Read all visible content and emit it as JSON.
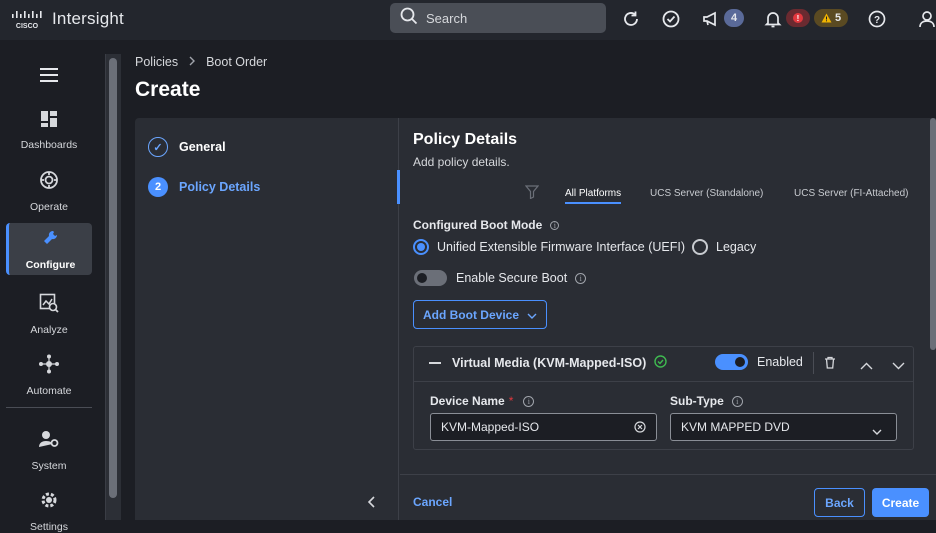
{
  "app": {
    "brand": "Intersight"
  },
  "topbar": {
    "search_label": "Search",
    "announcements_count": "4",
    "alarms_critical_icon": "!",
    "alarms_warning_count": "5",
    "help_icon": "?"
  },
  "sidebar": {
    "items": [
      {
        "label": "Dashboards",
        "icon": "dashboards-icon"
      },
      {
        "label": "Operate",
        "icon": "operate-icon"
      },
      {
        "label": "Configure",
        "icon": "configure-icon"
      },
      {
        "label": "Analyze",
        "icon": "analyze-icon"
      },
      {
        "label": "Automate",
        "icon": "automate-icon"
      },
      {
        "label": "System",
        "icon": "system-icon"
      },
      {
        "label": "Settings",
        "icon": "settings-icon"
      }
    ]
  },
  "breadcrumb": {
    "items": [
      "Policies",
      "Boot Order"
    ]
  },
  "page": {
    "title": "Create"
  },
  "steps": [
    {
      "label": "General",
      "marker": "✓"
    },
    {
      "label": "Policy Details",
      "marker": "2"
    }
  ],
  "policy": {
    "title": "Policy Details",
    "subtitle": "Add policy details.",
    "tabs": [
      "All Platforms",
      "UCS Server (Standalone)",
      "UCS Server (FI-Attached)"
    ],
    "boot_mode_label": "Configured Boot Mode",
    "boot_mode_options": [
      "Unified Extensible Firmware Interface (UEFI)",
      "Legacy"
    ],
    "secure_boot_label": "Enable Secure Boot",
    "add_device_label": "Add Boot Device"
  },
  "device": {
    "title": "Virtual Media (KVM-Mapped-ISO)",
    "enabled_label": "Enabled",
    "name_label": "Device Name",
    "required_mark": "*",
    "name_value": "KVM-Mapped-ISO",
    "subtype_label": "Sub-Type",
    "subtype_value": "KVM MAPPED DVD"
  },
  "footer": {
    "cancel": "Cancel",
    "back": "Back",
    "create": "Create"
  },
  "colors": {
    "accent": "#4a90ff",
    "critical": "#e0383e",
    "warning": "#f0b400",
    "success": "#3fb950"
  }
}
